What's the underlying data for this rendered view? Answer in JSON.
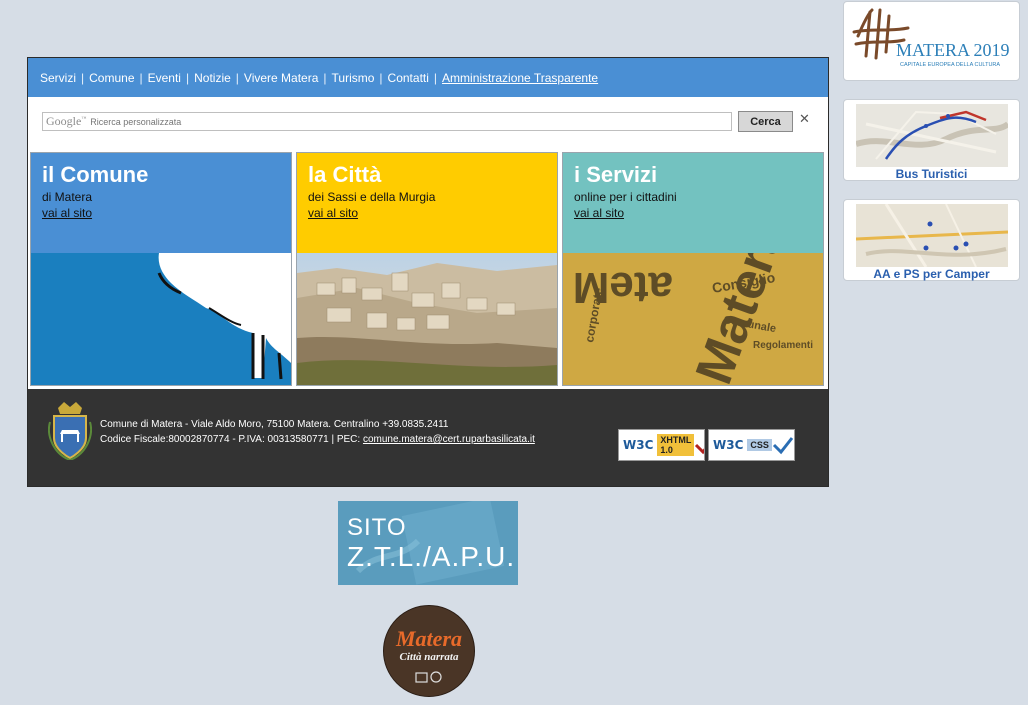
{
  "nav": {
    "items": [
      "Servizi",
      "Comune",
      "Eventi",
      "Notizie",
      "Vivere Matera",
      "Turismo",
      "Contatti"
    ],
    "highlight": "Amministrazione Trasparente",
    "separator": "|"
  },
  "search": {
    "logo": "Google",
    "logo_tm": "™",
    "placeholder": "Ricerca personalizzata",
    "button": "Cerca",
    "clear": "✕"
  },
  "panels": [
    {
      "title": "il Comune",
      "subtitle": "di Matera",
      "link": "vai al sito"
    },
    {
      "title": "la Città",
      "subtitle": "dei Sassi e della Murgia",
      "link": "vai al sito"
    },
    {
      "title": "i Servizi",
      "subtitle": "online per i cittadini",
      "link": "vai al sito"
    }
  ],
  "footer": {
    "line1": "Comune di Matera - Viale Aldo Moro, 75100 Matera. Centralino +39.0835.2411",
    "line2_prefix": "Codice Fiscale:80002870774 - P.IVA: 00313580771 | PEC: ",
    "email": "comune.matera@cert.ruparbasilicata.it",
    "badges": [
      {
        "w3c": "W3C",
        "label": "XHTML 1.0"
      },
      {
        "w3c": "W3C",
        "label": "CSS"
      }
    ]
  },
  "sidebar": {
    "logo_text": "MATERA 2019",
    "logo_sub": "CAPITALE EUROPEA DELLA CULTURA",
    "bus_caption": "Bus Turistici",
    "camper_caption": "AA e PS per Camper"
  },
  "ztl": {
    "line1": "SITO",
    "line2": "Z.T.L./A.P.U."
  },
  "citta_narrata": {
    "title": "Matera",
    "subtitle": "Città narrata"
  },
  "colors": {
    "nav_bg": "#4a8fd4",
    "comune": "#4a8fd4",
    "citta": "#ffcc00",
    "servizi": "#73c2c0",
    "footer_bg": "#333333",
    "page_bg": "#d6dde6"
  }
}
